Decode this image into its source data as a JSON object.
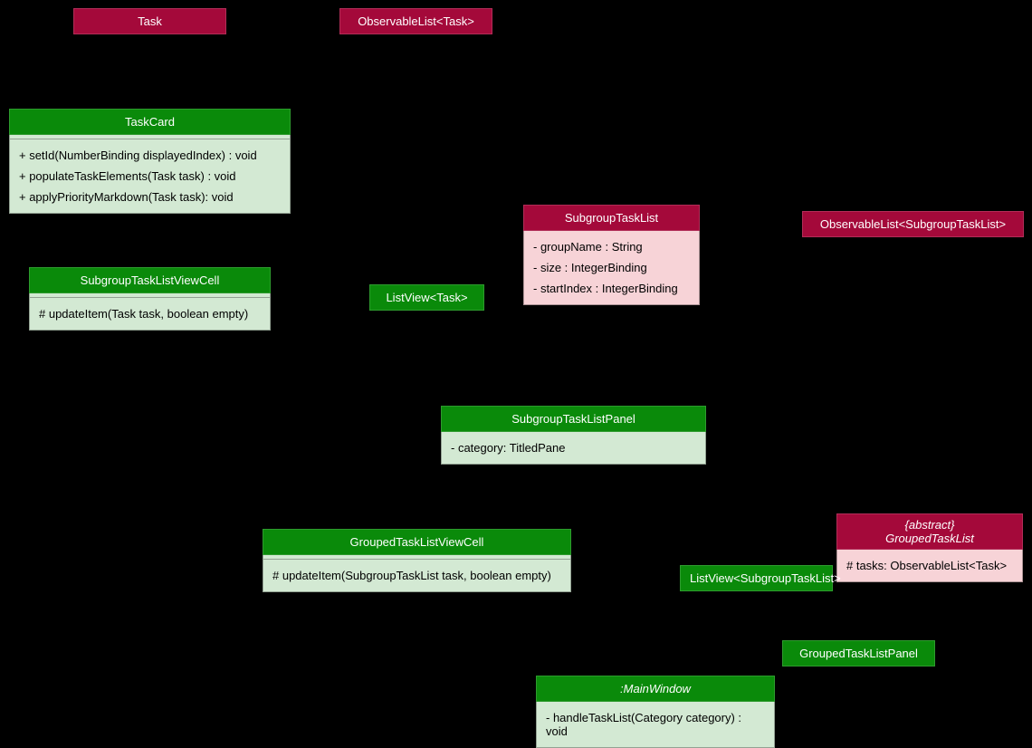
{
  "task": {
    "title": "Task"
  },
  "obsTask": {
    "title": "ObservableList<Task>"
  },
  "taskCard": {
    "title": "TaskCard",
    "m1": "+ setId(NumberBinding displayedIndex) : void",
    "m2": "+ populateTaskElements(Task task) : void",
    "m3": "+ applyPriorityMarkdown(Task task): void"
  },
  "subCell": {
    "title": "SubgroupTaskListViewCell",
    "m1": "# updateItem(Task task, boolean empty)"
  },
  "listViewTask": {
    "title": "ListView<Task>"
  },
  "subList": {
    "title": "SubgroupTaskList",
    "f1": "- groupName : String",
    "f2": "- size : IntegerBinding",
    "f3": "- startIndex : IntegerBinding"
  },
  "obsSub": {
    "title": "ObservableList<SubgroupTaskList>"
  },
  "subPanel": {
    "title": "SubgroupTaskListPanel",
    "f1": "- category: TitledPane"
  },
  "grpCell": {
    "title": "GroupedTaskListViewCell",
    "m1": "# updateItem(SubgroupTaskList task, boolean empty)"
  },
  "listViewSub": {
    "title": "ListView<SubgroupTaskList>"
  },
  "grpList": {
    "stereo": "{abstract}",
    "title": "GroupedTaskList",
    "f1": "# tasks: ObservableList<Task>"
  },
  "grpPanel": {
    "title": "GroupedTaskListPanel"
  },
  "main": {
    "title": ":MainWindow",
    "m1": "- handleTaskList(Category category) : void"
  }
}
